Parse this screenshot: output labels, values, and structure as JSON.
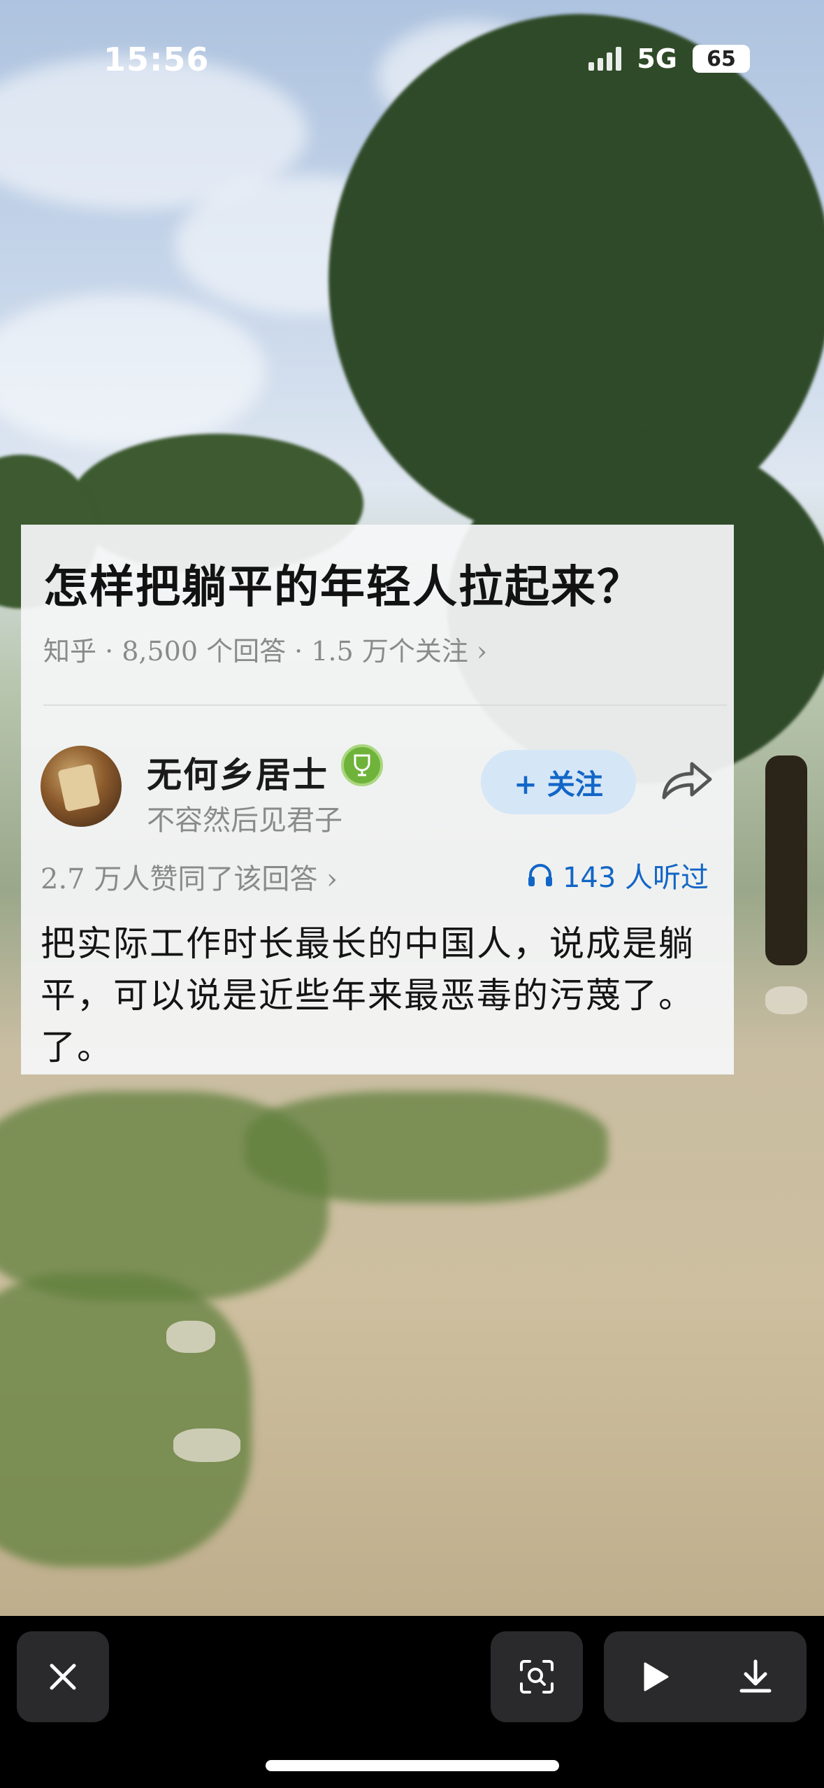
{
  "status_bar": {
    "time": "15:56",
    "network": "5G",
    "battery": "65"
  },
  "question": {
    "title": "怎样把躺平的年轻人拉起来？",
    "meta": "知乎 · 8,500 个回答 · 1.5 万个关注 ›"
  },
  "author": {
    "name": "无何乡居士",
    "signature": "不容然后见君子",
    "follow_label": "+ 关注"
  },
  "stats": {
    "votes": "2.7 万人赞同了该回答 ›",
    "listens": "143 人听过"
  },
  "answer": {
    "line1": "把实际工作时长最长的中国人，说成是躺",
    "line2": "平，可以说是近些年来最恶毒的污蔑了。",
    "line3": "了。"
  },
  "colors": {
    "accent": "#1266c7",
    "follow_bg": "#d5e6f7",
    "bar_bg": "#000000"
  },
  "icons": [
    "close-icon",
    "scan-icon",
    "play-icon",
    "download-icon",
    "share-icon",
    "headphones-icon",
    "badge-icon"
  ]
}
